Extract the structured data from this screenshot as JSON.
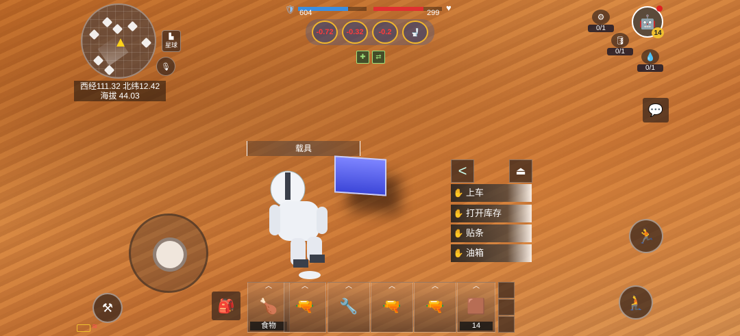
{
  "minimap": {
    "star_btn_label": "星球",
    "coords_line1": "西经111.32 北纬12.42",
    "coords_line2": "海拔 44.03"
  },
  "status": {
    "shield": "604",
    "health": "299",
    "shield_fraction": 0.73,
    "health_fraction": 0.73,
    "effects": [
      "-0.72",
      "-0.32",
      "-0.2",
      ""
    ]
  },
  "resources": [
    {
      "icon": "resource-icon",
      "count": "0/1"
    },
    {
      "icon": "barrel-icon",
      "count": "0/1"
    },
    {
      "icon": "water-icon",
      "count": "0/1"
    }
  ],
  "player": {
    "level": "14"
  },
  "vehicle": {
    "label": "载具"
  },
  "interaction_menu": {
    "items": [
      "上车",
      "打开库存",
      "贴条",
      "油箱"
    ]
  },
  "hotbar": {
    "slots": [
      {
        "name": "food",
        "label": "食物",
        "glyph": "🍗"
      },
      {
        "name": "shotgun",
        "label": "",
        "glyph": "🔫"
      },
      {
        "name": "tool-gun",
        "label": "",
        "glyph": "🔧"
      },
      {
        "name": "rifle",
        "label": "",
        "glyph": "🔫"
      },
      {
        "name": "blaster",
        "label": "",
        "glyph": "🔫"
      },
      {
        "name": "leather",
        "label": "14",
        "glyph": "🟫"
      }
    ]
  },
  "colors": {
    "shield_bar": "#3b8ee0",
    "health_bar": "#e03030",
    "accent": "#f1b62c"
  }
}
